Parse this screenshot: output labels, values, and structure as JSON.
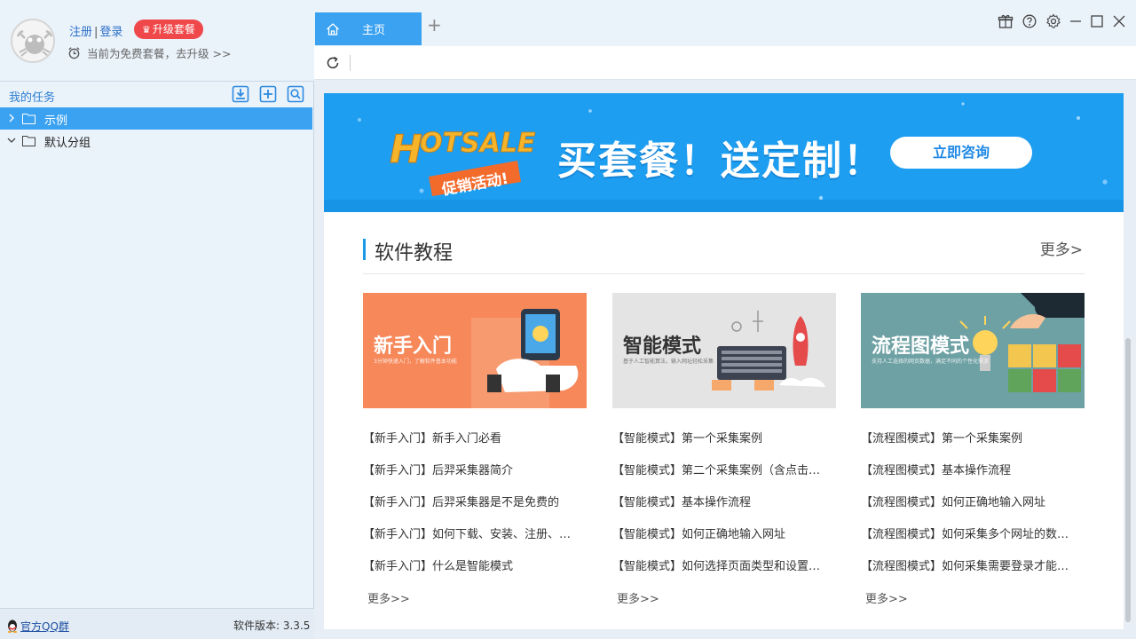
{
  "user": {
    "register_label": "注册",
    "separator": "|",
    "login_label": "登录",
    "upgrade_label": "升级套餐",
    "plan_text": "当前为免费套餐，去升级 >>"
  },
  "sidebar": {
    "title": "我的任务",
    "tree": [
      {
        "label": "示例",
        "expanded": false,
        "selected": true
      },
      {
        "label": "默认分组",
        "expanded": true,
        "selected": false
      }
    ],
    "footer": {
      "qq_label": "官方QQ群",
      "version_label": "软件版本: 3.3.5"
    }
  },
  "tabs": {
    "home_label": "主页",
    "add_label": "+"
  },
  "banner": {
    "hot_text": "HOTSALE",
    "promo_tag": "促销活动!",
    "title": "买套餐！送定制！",
    "button_label": "立即咨询"
  },
  "section": {
    "title": "软件教程",
    "more": "更多>"
  },
  "columns": [
    {
      "card_title": "新手入门",
      "card_sub": "3分钟快速入门，了解软件基本功能",
      "card_color": "#f6885a",
      "links": [
        "【新手入门】新手入门必看",
        "【新手入门】后羿采集器简介",
        "【新手入门】后羿采集器是不是免费的",
        "【新手入门】如何下载、安装、注册、…",
        "【新手入门】什么是智能模式"
      ],
      "more": "更多>>"
    },
    {
      "card_title": "智能模式",
      "card_sub": "基于人工智能算法，输入网址轻松采集",
      "card_color": "#e4e4e4",
      "links": [
        "【智能模式】第一个采集案例",
        "【智能模式】第二个采集案例（含点击…",
        "【智能模式】基本操作流程",
        "【智能模式】如何正确地输入网址",
        "【智能模式】如何选择页面类型和设置…"
      ],
      "more": "更多>>"
    },
    {
      "card_title": "流程图模式",
      "card_sub": "支持人工选择的网页数据，满足不同的个性化需求",
      "card_color": "#6ea1a4",
      "links": [
        "【流程图模式】第一个采集案例",
        "【流程图模式】基本操作流程",
        "【流程图模式】如何正确地输入网址",
        "【流程图模式】如何采集多个网址的数…",
        "【流程图模式】如何采集需要登录才能…"
      ],
      "more": "更多>>"
    }
  ],
  "colors": {
    "accent": "#3ba2f1",
    "upgrade": "#f0484a",
    "banner": "#1e9ef0"
  }
}
